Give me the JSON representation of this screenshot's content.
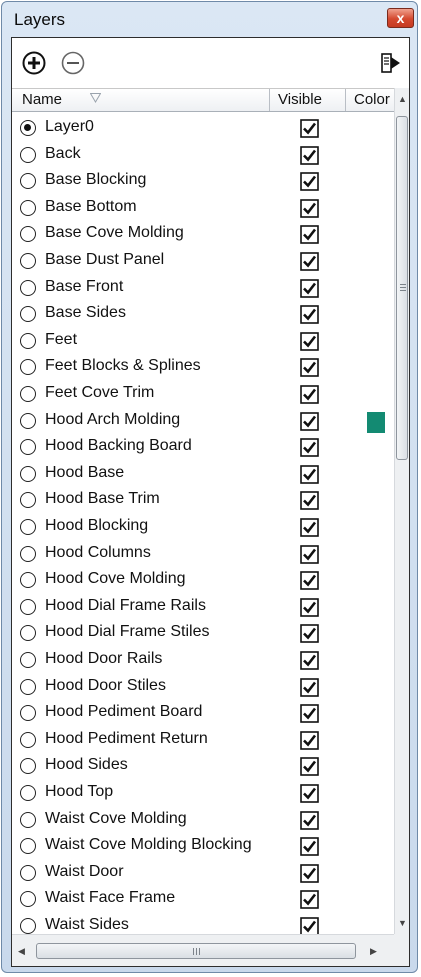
{
  "window": {
    "title": "Layers",
    "close_glyph": "x"
  },
  "toolbar": {
    "add_icon": "plus-circle-icon",
    "remove_icon": "minus-circle-icon",
    "details_icon": "details-arrow-icon"
  },
  "columns": {
    "name": "Name",
    "visible": "Visible",
    "color": "Color"
  },
  "colors": {
    "accent_swatch": "#138a72",
    "close_button": "#d04a30",
    "frame": "#c9d9ec"
  },
  "layers": [
    {
      "name": "Layer0",
      "active": true,
      "visible": true
    },
    {
      "name": "Back",
      "active": false,
      "visible": true
    },
    {
      "name": "Base Blocking",
      "active": false,
      "visible": true
    },
    {
      "name": "Base Bottom",
      "active": false,
      "visible": true
    },
    {
      "name": "Base Cove Molding",
      "active": false,
      "visible": true
    },
    {
      "name": "Base Dust Panel",
      "active": false,
      "visible": true
    },
    {
      "name": "Base Front",
      "active": false,
      "visible": true
    },
    {
      "name": "Base Sides",
      "active": false,
      "visible": true
    },
    {
      "name": "Feet",
      "active": false,
      "visible": true
    },
    {
      "name": "Feet Blocks & Splines",
      "active": false,
      "visible": true
    },
    {
      "name": "Feet Cove Trim",
      "active": false,
      "visible": true
    },
    {
      "name": "Hood Arch Molding",
      "active": false,
      "visible": true,
      "color": "#138a72"
    },
    {
      "name": "Hood Backing Board",
      "active": false,
      "visible": true
    },
    {
      "name": "Hood Base",
      "active": false,
      "visible": true
    },
    {
      "name": "Hood Base Trim",
      "active": false,
      "visible": true
    },
    {
      "name": "Hood Blocking",
      "active": false,
      "visible": true
    },
    {
      "name": "Hood Columns",
      "active": false,
      "visible": true
    },
    {
      "name": "Hood Cove Molding",
      "active": false,
      "visible": true
    },
    {
      "name": "Hood Dial Frame Rails",
      "active": false,
      "visible": true
    },
    {
      "name": "Hood Dial Frame Stiles",
      "active": false,
      "visible": true
    },
    {
      "name": "Hood Door Rails",
      "active": false,
      "visible": true
    },
    {
      "name": "Hood Door Stiles",
      "active": false,
      "visible": true
    },
    {
      "name": "Hood Pediment Board",
      "active": false,
      "visible": true
    },
    {
      "name": "Hood Pediment Return",
      "active": false,
      "visible": true
    },
    {
      "name": "Hood Sides",
      "active": false,
      "visible": true
    },
    {
      "name": "Hood Top",
      "active": false,
      "visible": true
    },
    {
      "name": "Waist Cove Molding",
      "active": false,
      "visible": true
    },
    {
      "name": "Waist Cove Molding Blocking",
      "active": false,
      "visible": true
    },
    {
      "name": "Waist Door",
      "active": false,
      "visible": true
    },
    {
      "name": "Waist Face Frame",
      "active": false,
      "visible": true
    },
    {
      "name": "Waist Sides",
      "active": false,
      "visible": true
    }
  ]
}
